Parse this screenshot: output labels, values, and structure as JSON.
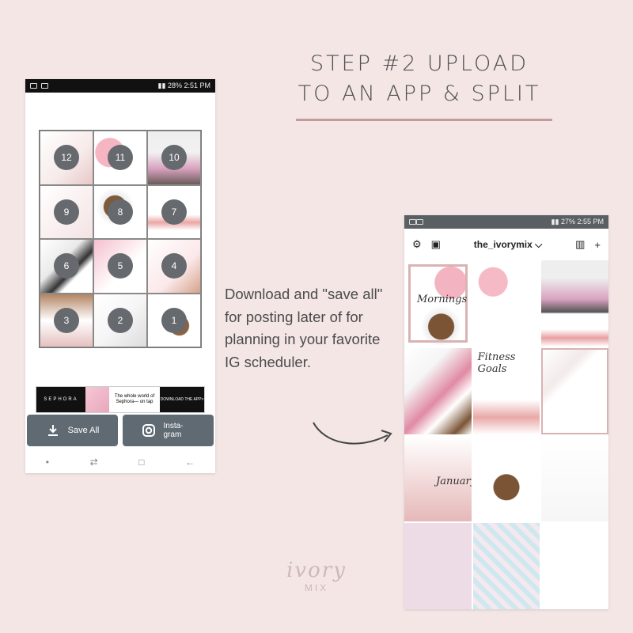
{
  "heading": {
    "line1": "STEP #2 UPLOAD",
    "line2": "TO AN APP & SPLIT"
  },
  "phone1": {
    "status": {
      "battery": "28%",
      "time": "2:51 PM"
    },
    "tiles": [
      "12",
      "11",
      "10",
      "9",
      "8",
      "7",
      "6",
      "5",
      "4",
      "3",
      "2",
      "1"
    ],
    "ad": {
      "brand": "SEPHORA",
      "text": "The whole world of Sephora— on tap",
      "cta": "DOWNLOAD THE APP>"
    },
    "buttons": {
      "save_all": "Save All",
      "instagram": "Insta-gram"
    }
  },
  "middle_text": "Download and \"save all\" for posting later of for planning in your favorite IG scheduler.",
  "phone2": {
    "status": {
      "battery": "27%",
      "time": "2:55 PM"
    },
    "username": "the_ivorymix",
    "scripts": {
      "mornings": "Mornings",
      "fitness": "Fitness Goals",
      "january": "January"
    }
  },
  "watermark": {
    "script": "ivory",
    "mix": "MIX"
  },
  "colors": {
    "background": "#f3e6e5",
    "accent": "#c79a9a",
    "badge": "#666a6e",
    "button": "#606a72"
  }
}
